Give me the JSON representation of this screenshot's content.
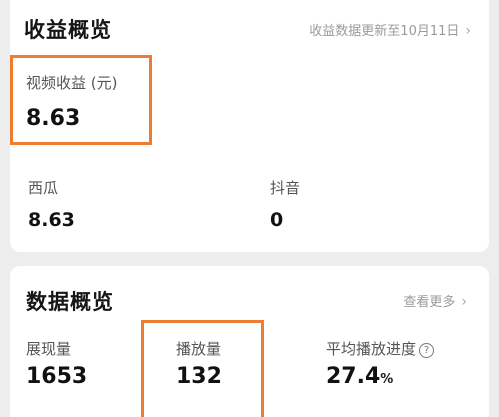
{
  "income_overview": {
    "title": "收益概览",
    "update_note": "收益数据更新至10月11日",
    "video_income": {
      "label": "视频收益 (元)",
      "value": "8.63"
    },
    "platforms": [
      {
        "label": "西瓜",
        "value": "8.63"
      },
      {
        "label": "抖音",
        "value": "0"
      }
    ]
  },
  "data_overview": {
    "title": "数据概览",
    "more_link": "查看更多",
    "metrics": [
      {
        "label": "展现量",
        "value": "1653"
      },
      {
        "label": "播放量",
        "value": "132"
      },
      {
        "label": "平均播放进度",
        "value": "27.4",
        "unit": "%"
      }
    ]
  },
  "colors": {
    "highlight": "#ee7d31",
    "background": "#ededee",
    "card": "#ffffff"
  },
  "icons": {
    "chevron": "chevron-right-icon",
    "help": "help-circle-icon"
  }
}
